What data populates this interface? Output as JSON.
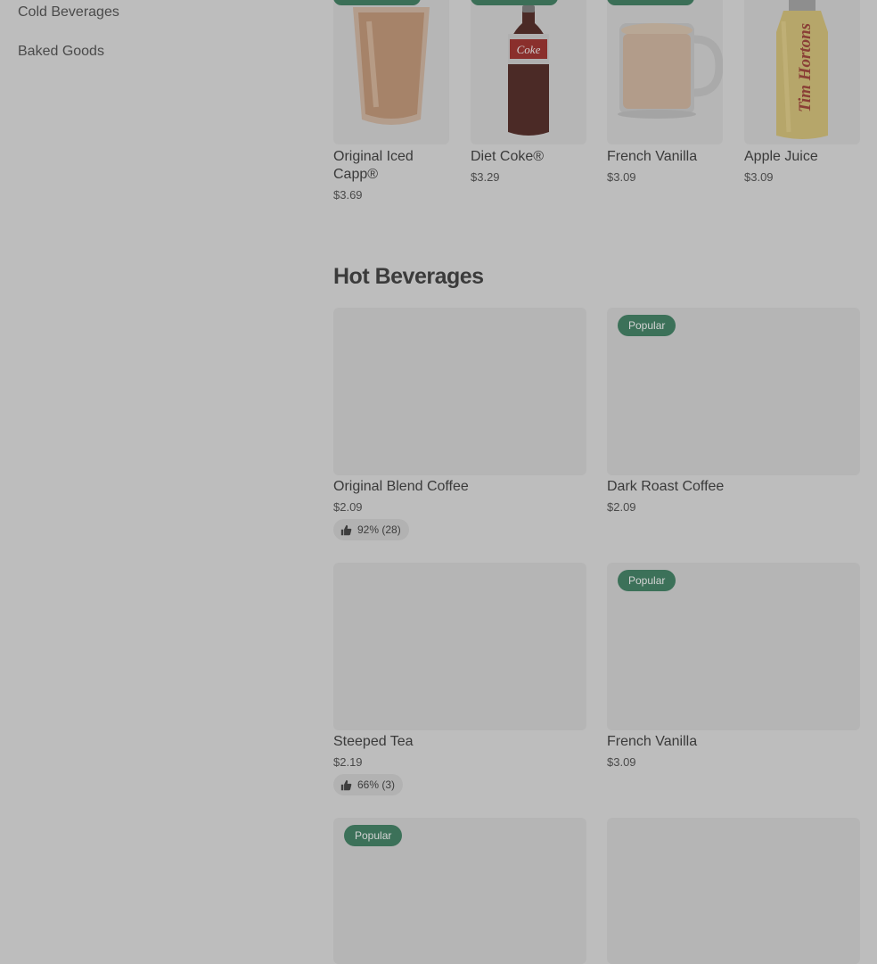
{
  "sidebar": {
    "items": [
      {
        "label": "Cold Beverages"
      },
      {
        "label": "Baked Goods"
      }
    ]
  },
  "top_row": {
    "items": [
      {
        "name": "Original Iced Capp®",
        "price": "$3.69",
        "icon": "iced-capp-image"
      },
      {
        "name": "Diet Coke®",
        "price": "$3.29",
        "icon": "diet-coke-bottle-image"
      },
      {
        "name": "French Vanilla",
        "price": "$3.09",
        "icon": "french-vanilla-mug-image"
      },
      {
        "name": "Apple Juice",
        "price": "$3.09",
        "icon": "apple-juice-bottle-image",
        "bottle_label": "Tim Hortons"
      }
    ]
  },
  "hot_beverages": {
    "title": "Hot Beverages",
    "items": [
      {
        "name": "Original Blend Coffee",
        "price": "$2.09",
        "rating": "92% (28)"
      },
      {
        "name": "Dark Roast Coffee",
        "price": "$2.09",
        "badge": "Popular"
      },
      {
        "name": "Steeped Tea",
        "price": "$2.19",
        "rating": "66% (3)"
      },
      {
        "name": "French Vanilla",
        "price": "$3.09",
        "badge": "Popular"
      },
      {
        "badge": "Popular"
      },
      {}
    ]
  },
  "colors": {
    "overlay_bg": "#bdbdbd",
    "badge_green": "#3c7159",
    "placeholder": "#b5b5b5"
  }
}
